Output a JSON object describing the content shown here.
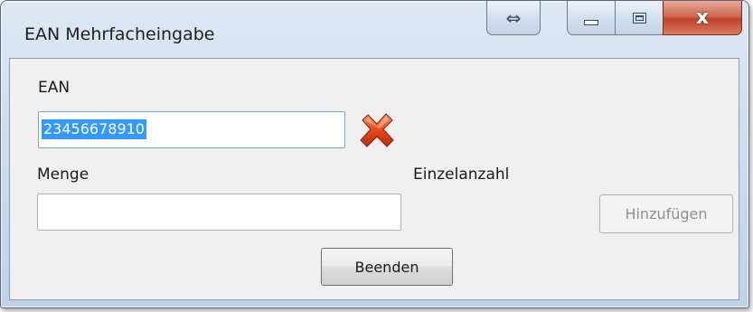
{
  "window": {
    "title": "EAN Mehrfacheingabe",
    "controls": {
      "resize_glyph": "⇔",
      "close_glyph": "x"
    }
  },
  "form": {
    "ean_label": "EAN",
    "ean_value": "23456678910",
    "ean_status_icon": "red-x-icon",
    "menge_label": "Menge",
    "menge_value": "",
    "einzelanzahl_label": "Einzelanzahl"
  },
  "buttons": {
    "add_label": "Hinzufügen",
    "add_enabled": false,
    "end_label": "Beenden"
  },
  "colors": {
    "selection": "#3399ff",
    "close_button": "#c0432a",
    "error_icon": "#e0401a"
  }
}
